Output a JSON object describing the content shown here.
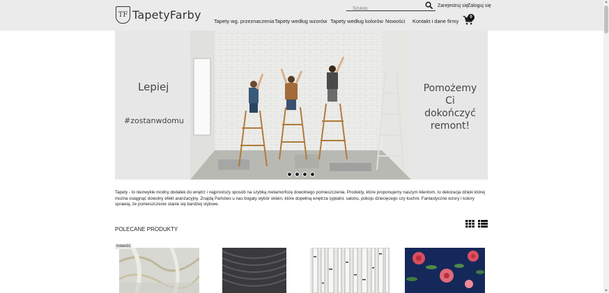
{
  "brand": {
    "logo_mark": "TF",
    "name": "TapetyFarby"
  },
  "search": {
    "placeholder": "Szukaj"
  },
  "account": {
    "register": "Zarejestruj się",
    "login": "Zaloguj się"
  },
  "nav": [
    {
      "label": "Tapety wg. przeznaczenia"
    },
    {
      "label": "Tapety według wzorów"
    },
    {
      "label": "Tapety według kolorów"
    },
    {
      "label": "Nowości"
    },
    {
      "label": "Kontakt i dane firmy"
    }
  ],
  "cart": {
    "count": "0"
  },
  "banner": {
    "left_line1": "Lepiej",
    "left_line2": "#zostanwdomu",
    "right_lines": [
      "Pomożemy",
      "Ci",
      "dokończyć",
      "remont!"
    ],
    "slide_count": 4
  },
  "description": "Tapety - to niezwykle modny dodatek do wnętrz i najprostszy sposób na szybką metamorfozę dowolnego pomieszczenia. Produkty, które proponujemy naszym klientom, to dekoracja dzięki której można osiągnąć dowolny efekt aranżacyjny. Znajdą Państwo u nas bogaty wybór oklein, które dopełnią wnętrza sypialni, salonu, pokoju dziecięcego czy kuchni. Fantastyczne wzory i kolory sprawią, że pomieszczenie stanie się bardziej stylowe.",
  "recommended": {
    "title": "POLECANE PRODUKTY",
    "new_badge": "nowość"
  },
  "colors": {
    "header_bg": "#ebebeb",
    "banner_side_bg": "#e7e7e7",
    "product4_bg": "#15285a"
  }
}
